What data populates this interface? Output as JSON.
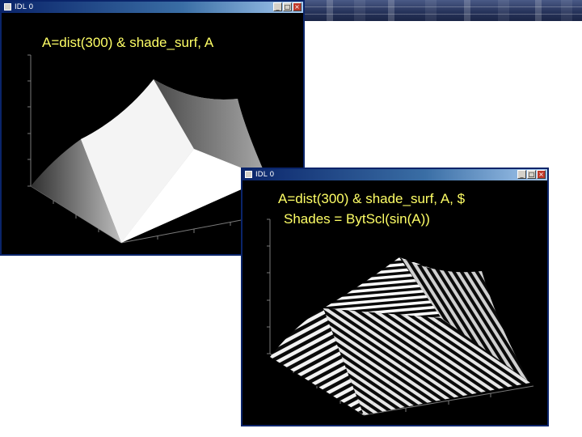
{
  "window1": {
    "title": "IDL 0",
    "caption": "A=dist(300) & shade_surf, A",
    "controls": {
      "minimize_icon": "minimize-icon",
      "maximize_icon": "maximize-icon",
      "close_icon": "close-icon"
    }
  },
  "window2": {
    "title": "IDL 0",
    "caption_line1": "A=dist(300) & shade_surf, A, $",
    "caption_line2": "Shades = BytScl(sin(A))",
    "controls": {
      "minimize_icon": "minimize-icon",
      "maximize_icon": "maximize-icon",
      "close_icon": "close-icon"
    }
  },
  "colors": {
    "caption": "#ffff66",
    "plot_background": "#000000",
    "titlebar": "#0a246a",
    "close_button": "#c0392b"
  }
}
